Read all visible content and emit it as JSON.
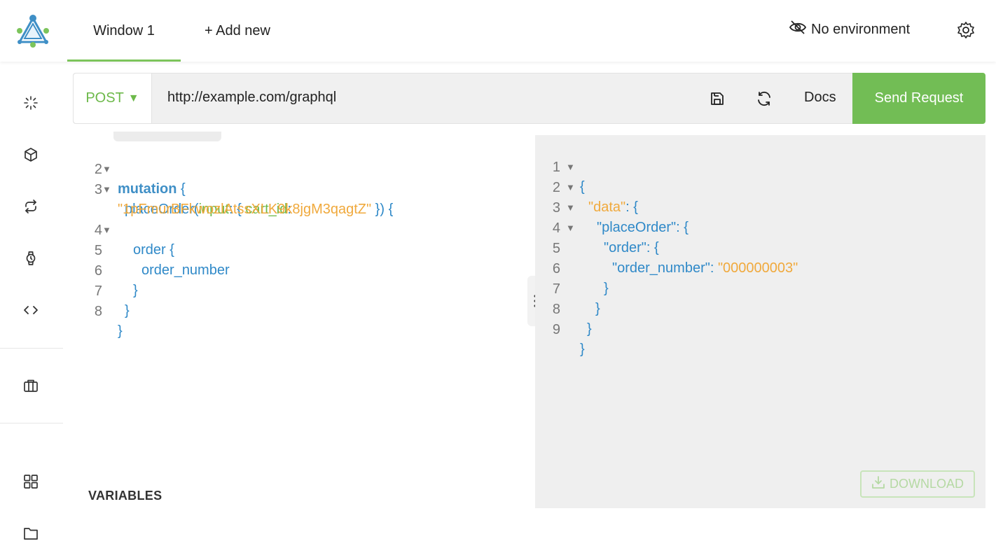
{
  "header": {
    "tabs": [
      {
        "label": "Window 1",
        "active": true
      },
      {
        "label": "+ Add new"
      }
    ],
    "environment": "No environment"
  },
  "request": {
    "method": "POST",
    "url": "http://example.com/graphql",
    "docs_label": "Docs",
    "send_label": "Send Request"
  },
  "editor": {
    "lines": [
      {
        "n": "2",
        "fold": true
      },
      {
        "n": "3",
        "fold": true
      },
      {
        "n": "",
        "fold": false
      },
      {
        "n": "4",
        "fold": true
      },
      {
        "n": "5",
        "fold": false
      },
      {
        "n": "6",
        "fold": false
      },
      {
        "n": "7",
        "fold": false
      },
      {
        "n": "8",
        "fold": false
      }
    ],
    "tokens": {
      "mutation": "mutation",
      "brace_open": " {",
      "placeOrder": "placeOrder(",
      "input": "input",
      "colon_brace": ": { ",
      "cart_id": "cart_id",
      "colon": ":",
      "cart_value": "\"1pFmurBFkwozlAtssXLK9k8jgM3qagtZ\"",
      "close_args": " }) {",
      "order": "order {",
      "order_number": "order_number",
      "close": "}"
    },
    "variables_label": "VARIABLES"
  },
  "result": {
    "lines": [
      {
        "n": "1",
        "fold": true
      },
      {
        "n": "2",
        "fold": true
      },
      {
        "n": "3",
        "fold": true
      },
      {
        "n": "4",
        "fold": true
      },
      {
        "n": "5",
        "fold": false
      },
      {
        "n": "6",
        "fold": false
      },
      {
        "n": "7",
        "fold": false
      },
      {
        "n": "8",
        "fold": false
      },
      {
        "n": "9",
        "fold": false
      }
    ],
    "tokens": {
      "open": "{",
      "data_key": "\"data\"",
      "placeOrder_key": "\"placeOrder\"",
      "order_key": "\"order\"",
      "order_number_key": "\"order_number\"",
      "colon_brace": ": {",
      "colon": ": ",
      "order_number_value": "\"000000003\"",
      "close": "}"
    },
    "download_label": "DOWNLOAD"
  },
  "colors": {
    "accent": "#72bd55",
    "string": "#f0a93c",
    "keyword": "#3f8fc6"
  }
}
